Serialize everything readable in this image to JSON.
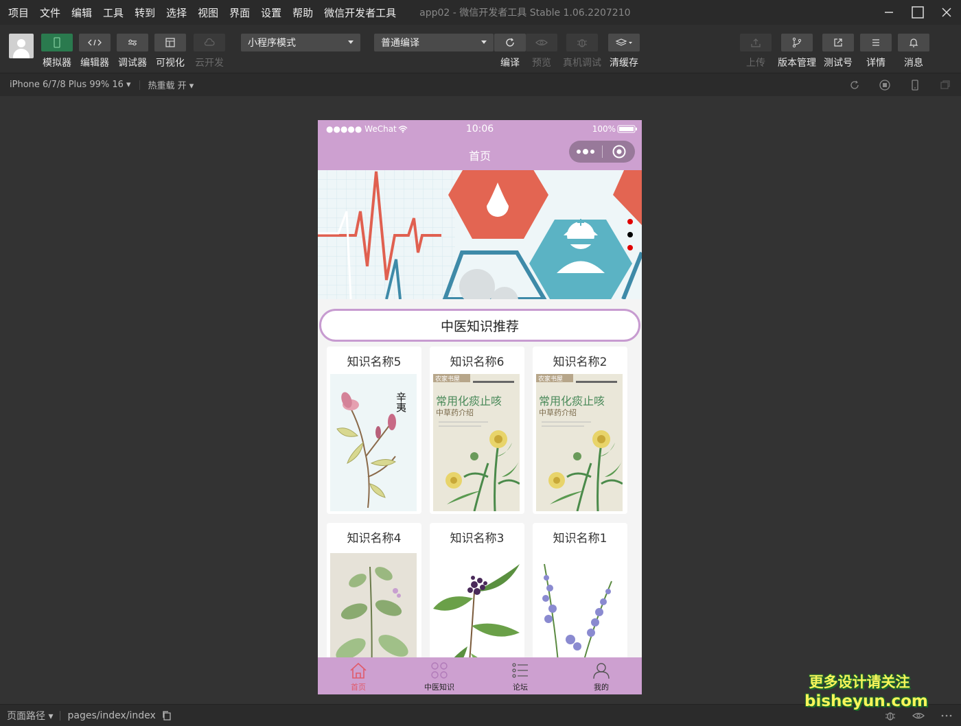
{
  "menubar": {
    "items": [
      "项目",
      "文件",
      "编辑",
      "工具",
      "转到",
      "选择",
      "视图",
      "界面",
      "设置",
      "帮助",
      "微信开发者工具"
    ],
    "app_title": "app02 - 微信开发者工具 Stable 1.06.2207210"
  },
  "toolbar": {
    "left_buttons": [
      {
        "label": "模拟器",
        "icon": "phone-icon",
        "active": true,
        "disabled": false
      },
      {
        "label": "编辑器",
        "icon": "code-icon",
        "active": false,
        "disabled": false
      },
      {
        "label": "调试器",
        "icon": "debug-toggle-icon",
        "active": false,
        "disabled": false
      },
      {
        "label": "可视化",
        "icon": "layout-icon",
        "active": false,
        "disabled": false
      },
      {
        "label": "云开发",
        "icon": "cloud-icon",
        "active": false,
        "disabled": true
      }
    ],
    "mode_select": "小程序模式",
    "compile_select": "普通编译",
    "center_buttons": [
      {
        "label": "编译",
        "icon": "refresh-icon",
        "disabled": false
      },
      {
        "label": "预览",
        "icon": "eye-icon",
        "disabled": true
      },
      {
        "label": "真机调试",
        "icon": "bug-icon",
        "disabled": true
      },
      {
        "label": "清缓存",
        "icon": "layers-icon",
        "disabled": false
      }
    ],
    "right_buttons": [
      {
        "label": "上传",
        "icon": "upload-icon",
        "disabled": true
      },
      {
        "label": "版本管理",
        "icon": "branch-icon",
        "disabled": false
      },
      {
        "label": "测试号",
        "icon": "external-link-icon",
        "disabled": false
      },
      {
        "label": "详情",
        "icon": "menu-icon",
        "disabled": false
      },
      {
        "label": "消息",
        "icon": "bell-icon",
        "disabled": false
      }
    ]
  },
  "subbar": {
    "device": "iPhone 6/7/8 Plus 99% 16 ▾",
    "hot_reload": "热重载 开 ▾"
  },
  "phone": {
    "status": {
      "carrier": "●●●●● WeChat",
      "time": "10:06",
      "battery": "100%"
    },
    "nav_title": "首页",
    "section_title": "中医知识推荐",
    "cards": [
      {
        "name": "知识名称5",
        "art": "magnolia"
      },
      {
        "name": "知识名称6",
        "art": "book"
      },
      {
        "name": "知识名称2",
        "art": "book"
      },
      {
        "name": "知识名称4",
        "art": "leaves"
      },
      {
        "name": "知识名称3",
        "art": "berries"
      },
      {
        "name": "知识名称1",
        "art": "flowers"
      }
    ],
    "book_cover": {
      "series": "农家书屋",
      "title": "常用化痰止咳",
      "subtitle": "中草药介绍"
    },
    "magnolia_caption": "辛夷",
    "tabs": [
      {
        "label": "首页",
        "icon": "home-icon",
        "active": true
      },
      {
        "label": "中医知识",
        "icon": "grid-flower-icon",
        "active": false
      },
      {
        "label": "论坛",
        "icon": "list-icon",
        "active": false
      },
      {
        "label": "我的",
        "icon": "user-icon",
        "active": false
      }
    ]
  },
  "bottombar": {
    "path_label": "页面路径 ▾",
    "path": "pages/index/index"
  },
  "watermark": {
    "line1": "更多设计请关注",
    "line2": "bisheyun.com"
  }
}
